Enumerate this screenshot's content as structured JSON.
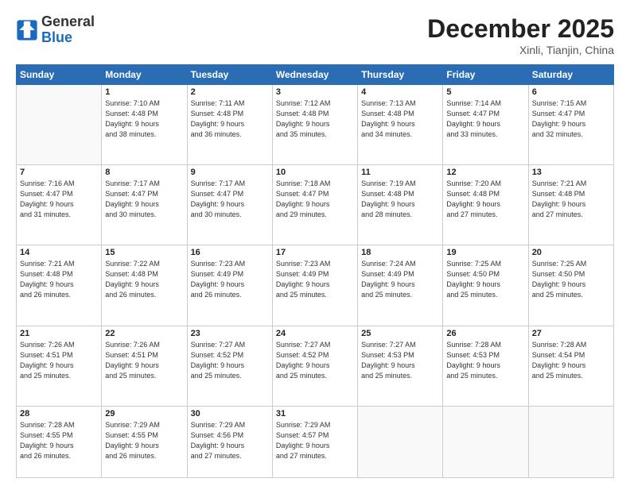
{
  "header": {
    "logo_general": "General",
    "logo_blue": "Blue",
    "month_title": "December 2025",
    "location": "Xinli, Tianjin, China"
  },
  "days_of_week": [
    "Sunday",
    "Monday",
    "Tuesday",
    "Wednesday",
    "Thursday",
    "Friday",
    "Saturday"
  ],
  "weeks": [
    [
      {
        "day": "",
        "info": ""
      },
      {
        "day": "1",
        "info": "Sunrise: 7:10 AM\nSunset: 4:48 PM\nDaylight: 9 hours\nand 38 minutes."
      },
      {
        "day": "2",
        "info": "Sunrise: 7:11 AM\nSunset: 4:48 PM\nDaylight: 9 hours\nand 36 minutes."
      },
      {
        "day": "3",
        "info": "Sunrise: 7:12 AM\nSunset: 4:48 PM\nDaylight: 9 hours\nand 35 minutes."
      },
      {
        "day": "4",
        "info": "Sunrise: 7:13 AM\nSunset: 4:48 PM\nDaylight: 9 hours\nand 34 minutes."
      },
      {
        "day": "5",
        "info": "Sunrise: 7:14 AM\nSunset: 4:47 PM\nDaylight: 9 hours\nand 33 minutes."
      },
      {
        "day": "6",
        "info": "Sunrise: 7:15 AM\nSunset: 4:47 PM\nDaylight: 9 hours\nand 32 minutes."
      }
    ],
    [
      {
        "day": "7",
        "info": "Sunrise: 7:16 AM\nSunset: 4:47 PM\nDaylight: 9 hours\nand 31 minutes."
      },
      {
        "day": "8",
        "info": "Sunrise: 7:17 AM\nSunset: 4:47 PM\nDaylight: 9 hours\nand 30 minutes."
      },
      {
        "day": "9",
        "info": "Sunrise: 7:17 AM\nSunset: 4:47 PM\nDaylight: 9 hours\nand 30 minutes."
      },
      {
        "day": "10",
        "info": "Sunrise: 7:18 AM\nSunset: 4:47 PM\nDaylight: 9 hours\nand 29 minutes."
      },
      {
        "day": "11",
        "info": "Sunrise: 7:19 AM\nSunset: 4:48 PM\nDaylight: 9 hours\nand 28 minutes."
      },
      {
        "day": "12",
        "info": "Sunrise: 7:20 AM\nSunset: 4:48 PM\nDaylight: 9 hours\nand 27 minutes."
      },
      {
        "day": "13",
        "info": "Sunrise: 7:21 AM\nSunset: 4:48 PM\nDaylight: 9 hours\nand 27 minutes."
      }
    ],
    [
      {
        "day": "14",
        "info": "Sunrise: 7:21 AM\nSunset: 4:48 PM\nDaylight: 9 hours\nand 26 minutes."
      },
      {
        "day": "15",
        "info": "Sunrise: 7:22 AM\nSunset: 4:48 PM\nDaylight: 9 hours\nand 26 minutes."
      },
      {
        "day": "16",
        "info": "Sunrise: 7:23 AM\nSunset: 4:49 PM\nDaylight: 9 hours\nand 26 minutes."
      },
      {
        "day": "17",
        "info": "Sunrise: 7:23 AM\nSunset: 4:49 PM\nDaylight: 9 hours\nand 25 minutes."
      },
      {
        "day": "18",
        "info": "Sunrise: 7:24 AM\nSunset: 4:49 PM\nDaylight: 9 hours\nand 25 minutes."
      },
      {
        "day": "19",
        "info": "Sunrise: 7:25 AM\nSunset: 4:50 PM\nDaylight: 9 hours\nand 25 minutes."
      },
      {
        "day": "20",
        "info": "Sunrise: 7:25 AM\nSunset: 4:50 PM\nDaylight: 9 hours\nand 25 minutes."
      }
    ],
    [
      {
        "day": "21",
        "info": "Sunrise: 7:26 AM\nSunset: 4:51 PM\nDaylight: 9 hours\nand 25 minutes."
      },
      {
        "day": "22",
        "info": "Sunrise: 7:26 AM\nSunset: 4:51 PM\nDaylight: 9 hours\nand 25 minutes."
      },
      {
        "day": "23",
        "info": "Sunrise: 7:27 AM\nSunset: 4:52 PM\nDaylight: 9 hours\nand 25 minutes."
      },
      {
        "day": "24",
        "info": "Sunrise: 7:27 AM\nSunset: 4:52 PM\nDaylight: 9 hours\nand 25 minutes."
      },
      {
        "day": "25",
        "info": "Sunrise: 7:27 AM\nSunset: 4:53 PM\nDaylight: 9 hours\nand 25 minutes."
      },
      {
        "day": "26",
        "info": "Sunrise: 7:28 AM\nSunset: 4:53 PM\nDaylight: 9 hours\nand 25 minutes."
      },
      {
        "day": "27",
        "info": "Sunrise: 7:28 AM\nSunset: 4:54 PM\nDaylight: 9 hours\nand 25 minutes."
      }
    ],
    [
      {
        "day": "28",
        "info": "Sunrise: 7:28 AM\nSunset: 4:55 PM\nDaylight: 9 hours\nand 26 minutes."
      },
      {
        "day": "29",
        "info": "Sunrise: 7:29 AM\nSunset: 4:55 PM\nDaylight: 9 hours\nand 26 minutes."
      },
      {
        "day": "30",
        "info": "Sunrise: 7:29 AM\nSunset: 4:56 PM\nDaylight: 9 hours\nand 27 minutes."
      },
      {
        "day": "31",
        "info": "Sunrise: 7:29 AM\nSunset: 4:57 PM\nDaylight: 9 hours\nand 27 minutes."
      },
      {
        "day": "",
        "info": ""
      },
      {
        "day": "",
        "info": ""
      },
      {
        "day": "",
        "info": ""
      }
    ]
  ]
}
